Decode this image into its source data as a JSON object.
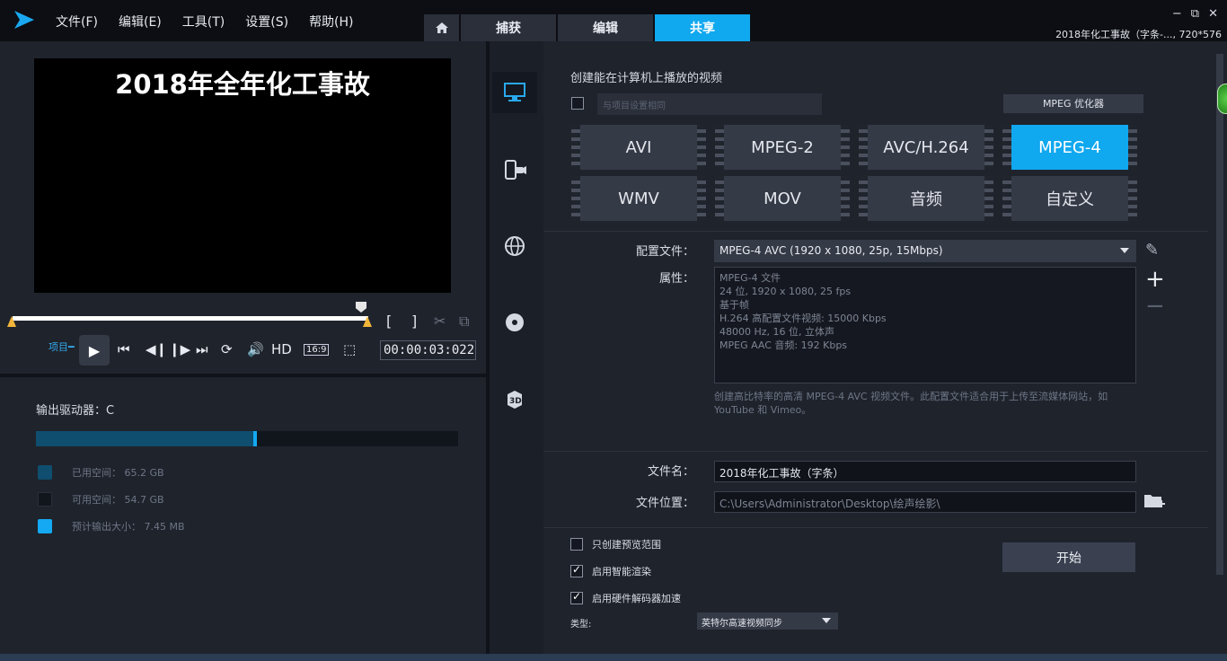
{
  "menu": [
    "文件(F)",
    "编辑(E)",
    "工具(T)",
    "设置(S)",
    "帮助(H)"
  ],
  "nav_tabs": [
    "捕获",
    "编辑",
    "共享"
  ],
  "window_controls": [
    "−",
    "⧉",
    "✕"
  ],
  "project_info": "2018年化工事故（字条-..., 720*576",
  "preview": {
    "title": "2018年全年化工事故"
  },
  "controls": {
    "mode_label": "项目",
    "hd_label": "HD",
    "aspect_label": "16:9",
    "timecode": "00:00:03:022"
  },
  "drive": {
    "label": "输出驱动器：C",
    "used_fraction": 0.52,
    "legend": [
      {
        "label": "已用空间： 65.2 GB",
        "color": "#0f4e6e"
      },
      {
        "label": "可用空间： 54.7 GB",
        "color": "#11151c"
      },
      {
        "label": "预计输出大小： 7.45 MB",
        "color": "#14a9f2"
      }
    ]
  },
  "share": {
    "heading": "创建能在计算机上播放的视频",
    "same_as_project_placeholder": "与项目设置相同",
    "mpeg_optimizer": "MPEG 优化器",
    "formats": [
      "AVI",
      "MPEG-2",
      "AVC/H.264",
      "MPEG-4",
      "WMV",
      "MOV",
      "音频",
      "自定义"
    ],
    "selected_format": "MPEG-4",
    "profile_label": "配置文件：",
    "profile_value": "MPEG-4 AVC (1920 x 1080, 25p, 15Mbps)",
    "properties_label": "属性：",
    "properties": [
      "MPEG-4 文件",
      "24 位, 1920 x 1080, 25 fps",
      "基于帧",
      "H.264 高配置文件视频: 15000 Kbps",
      "48000 Hz, 16 位, 立体声",
      "MPEG AAC 音频: 192 Kbps"
    ],
    "description": "创建高比特率的高清 MPEG-4 AVC 视频文件。此配置文件适合用于上传至流媒体网站，如 YouTube 和 Vimeo。",
    "filename_label": "文件名：",
    "filename_value": "2018年化工事故（字条）",
    "location_label": "文件位置：",
    "location_value": "C:\\Users\\Administrator\\Desktop\\绘声绘影\\",
    "options": [
      {
        "label": "只创建预览范围",
        "checked": false
      },
      {
        "label": "启用智能渲染",
        "checked": true
      },
      {
        "label": "启用硬件解码器加速",
        "checked": true
      }
    ],
    "type_label": "类型:",
    "type_value": "英特尔高速视频同步",
    "start_label": "开始"
  }
}
